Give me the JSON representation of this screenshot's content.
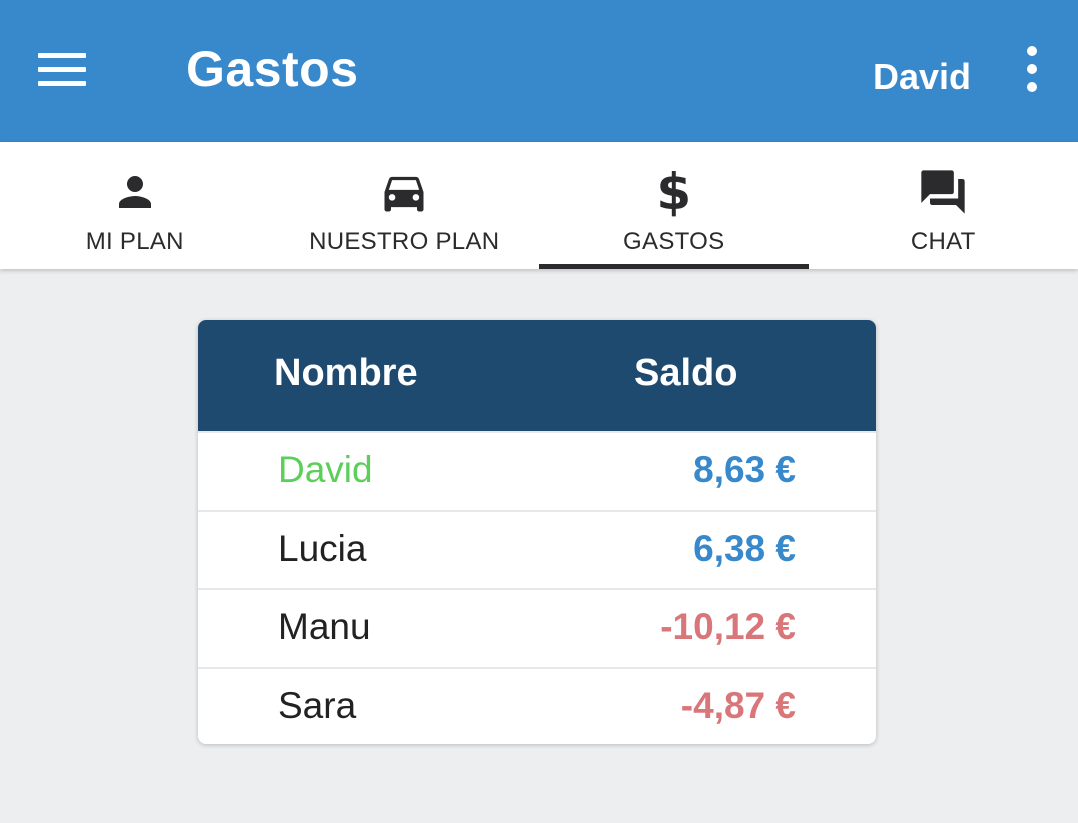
{
  "appbar": {
    "title": "Gastos",
    "user": "David",
    "menu_icon": "hamburger-menu-icon",
    "more_icon": "more-vertical-icon",
    "color": "#3888cc"
  },
  "tabs": [
    {
      "label": "MI PLAN",
      "icon": "person-icon",
      "active": false
    },
    {
      "label": "NUESTRO PLAN",
      "icon": "car-icon",
      "active": false
    },
    {
      "label": "GASTOS",
      "icon": "dollar-icon",
      "active": true
    },
    {
      "label": "CHAT",
      "icon": "chat-icon",
      "active": false
    }
  ],
  "table": {
    "headers": {
      "name": "Nombre",
      "balance": "Saldo"
    },
    "header_color": "#1f4a70",
    "rows": [
      {
        "name": "David",
        "balance": "8,63 €",
        "highlight": true
      },
      {
        "name": "Lucia",
        "balance": "6,38 €"
      },
      {
        "name": "Manu",
        "balance": "-10,12 €"
      },
      {
        "name": "Sara",
        "balance": "-4,87 €"
      }
    ],
    "colors": {
      "current_user": "#5ccf5a",
      "positive": "#3888cc",
      "negative": "#d9767a"
    }
  }
}
